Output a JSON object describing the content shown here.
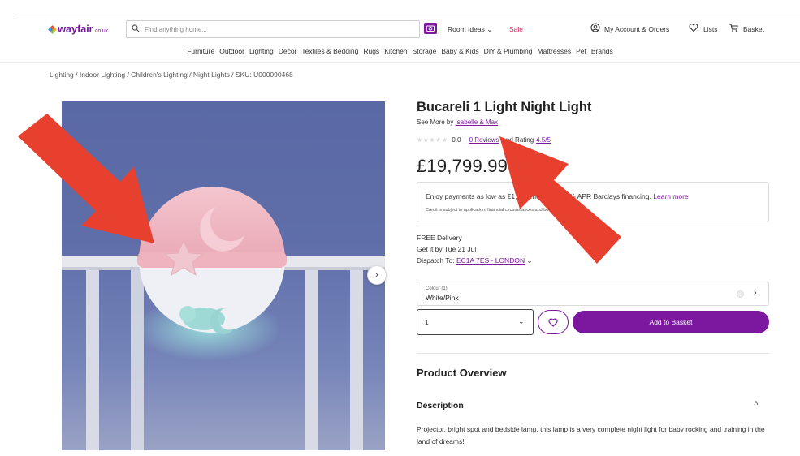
{
  "header": {
    "logo_text": "wayfair",
    "logo_tld": ".co.uk",
    "search_placeholder": "Find anything home...",
    "room_ideas": "Room Ideas",
    "sale": "Sale",
    "account": "My Account & Orders",
    "lists": "Lists",
    "basket": "Basket"
  },
  "categories": [
    "Furniture",
    "Outdoor",
    "Lighting",
    "Décor",
    "Textiles & Bedding",
    "Rugs",
    "Kitchen",
    "Storage",
    "Baby & Kids",
    "DIY & Plumbing",
    "Mattresses",
    "Pet",
    "Brands"
  ],
  "breadcrumb": "Lighting / Indoor Lighting / Children's Lighting / Night Lights / SKU: U000090468",
  "product": {
    "title": "Bucareli 1 Light Night Light",
    "see_more_prefix": "See More by ",
    "brand": "Isabelle & Max",
    "stars": "★★★★★",
    "rating_value": "0.0",
    "reviews_link": "0 Reviews",
    "rating_text": "and Rating",
    "rating_score": "4.5/5",
    "price": "£19,799.99",
    "finance_main": "Enjoy payments as low as £1,650/month with 0% APR Barclays financing.",
    "finance_link": "Learn more",
    "finance_sub": "Credit is subject to application, financial circumstances and borrowing history.",
    "delivery": "FREE Delivery",
    "get_it_by": "Get it by Tue 21 Jul",
    "dispatch_label": "Dispatch To:",
    "dispatch_link": "EC1A 7ES - LONDON",
    "colour_label": "Colour (1)",
    "colour_value": "White/Pink",
    "quantity": "1",
    "add_to_basket": "Add to Basket",
    "overview_heading": "Product Overview",
    "description_heading": "Description",
    "description": "Projector, bright spot and bedside lamp, this lamp is a very complete night light for baby rocking and training in the land of dreams!"
  },
  "colors": {
    "brand_purple": "#7b189f",
    "annotation_red": "#e8402f"
  }
}
